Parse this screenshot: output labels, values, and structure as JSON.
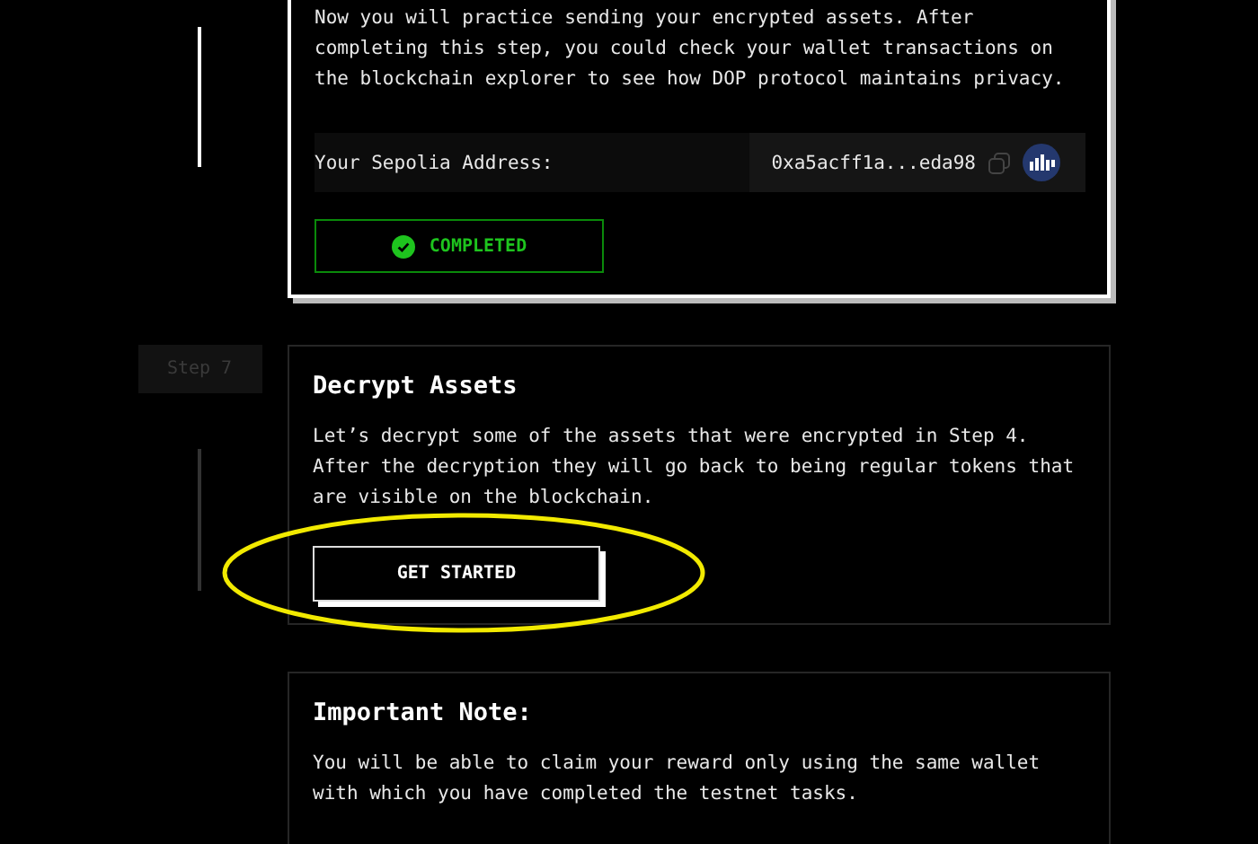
{
  "steps": [
    {
      "kind": "task",
      "completed": true,
      "description": "Now you will practice sending your encrypted assets. After completing this step, you could check your wallet transactions on the blockchain explorer to see how DOP protocol maintains privacy.",
      "address_label": "Your Sepolia Address:",
      "address": "0xa5acff1a...eda98",
      "badge": "COMPLETED"
    },
    {
      "kind": "task",
      "completed": false,
      "step_label": "Step 7",
      "title": "Decrypt Assets",
      "description": "Let’s decrypt some of the assets that were encrypted in Step 4. After the decryption they will go back to being regular tokens that are visible on the blockchain.",
      "button": "GET STARTED"
    },
    {
      "kind": "note",
      "title": "Important Note:",
      "description": "You will be able to claim your reward only using the same wallet with which you have completed the testnet tasks."
    }
  ]
}
